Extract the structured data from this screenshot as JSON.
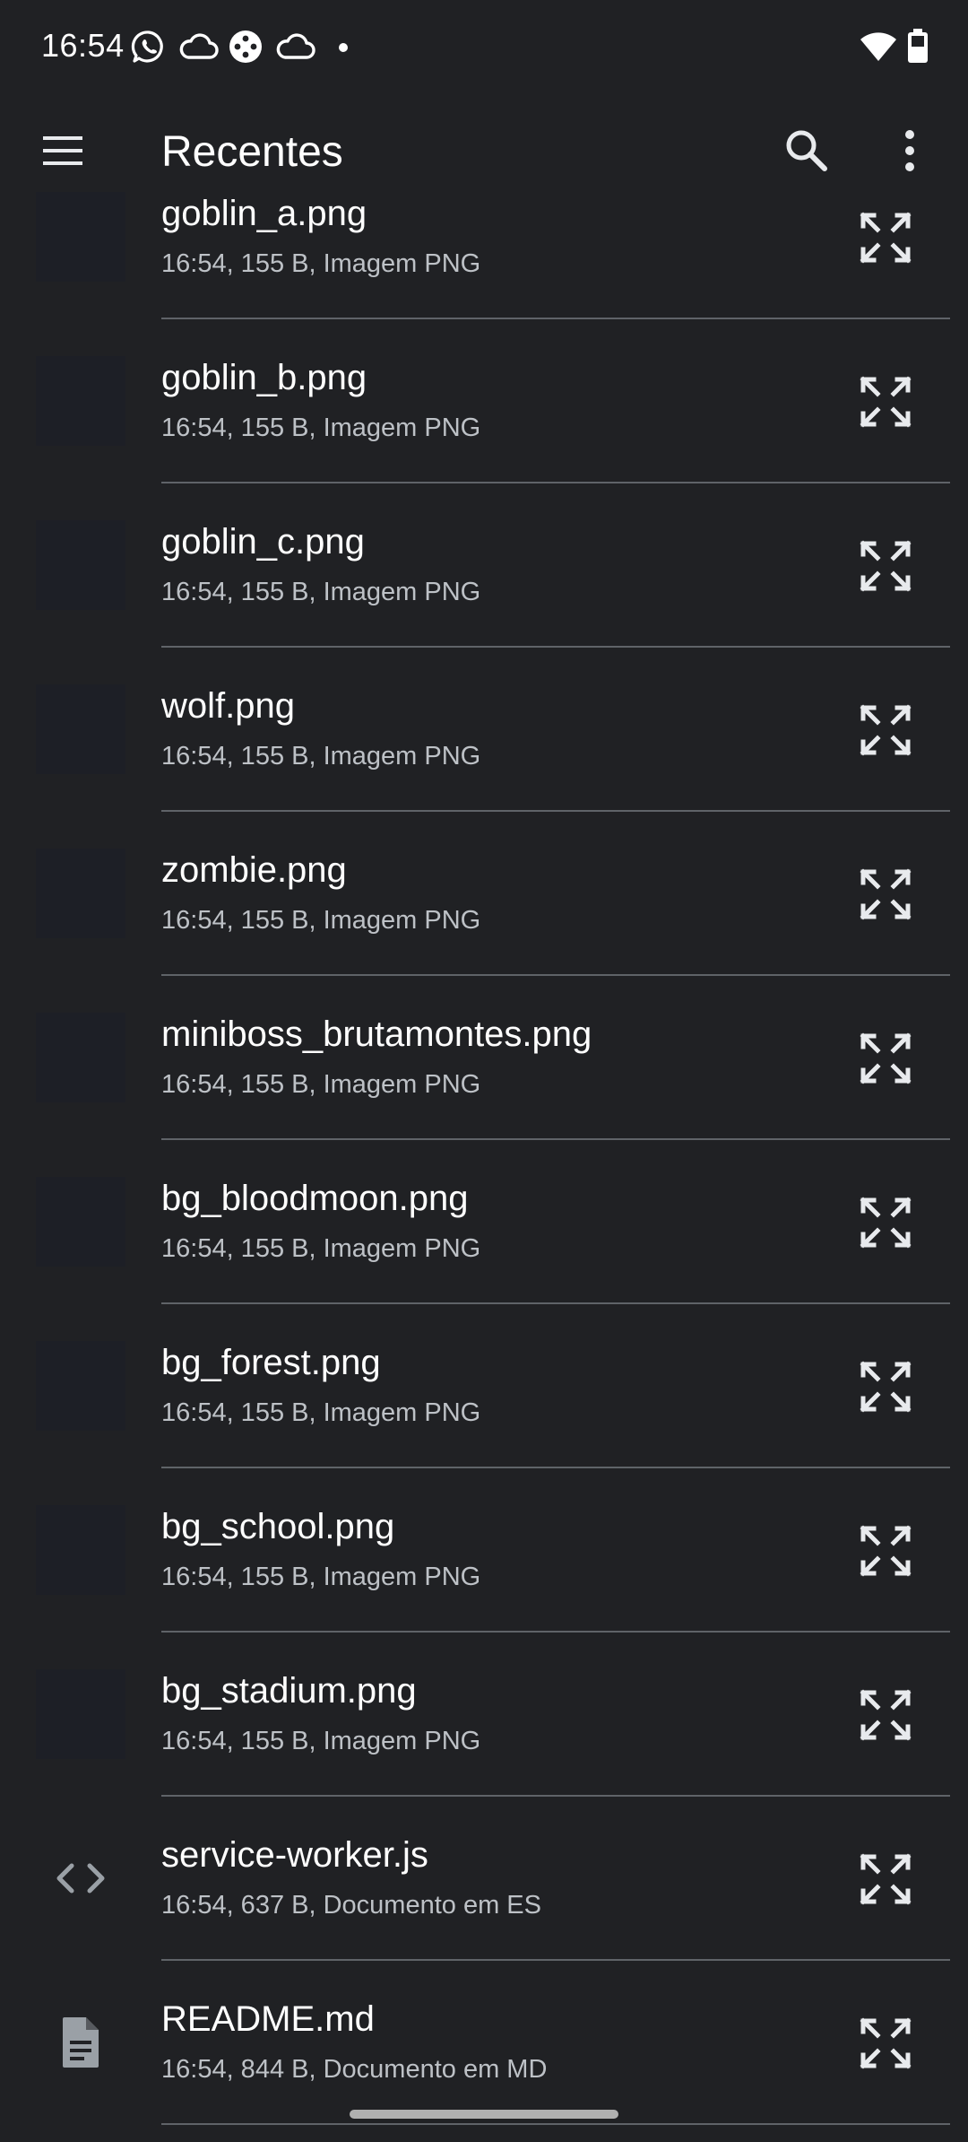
{
  "status_bar": {
    "time": "16:54",
    "icons": [
      "whatsapp-icon",
      "cloud-icon",
      "game-controller-icon",
      "cloud-icon",
      "wifi-icon",
      "battery-icon"
    ]
  },
  "app_bar": {
    "title": "Recentes",
    "menu_icon": "menu-icon",
    "search_icon": "search-icon",
    "more_icon": "more-vert-icon"
  },
  "files": [
    {
      "name": "goblin_a.png",
      "meta": "16:54, 155 B, Imagem PNG",
      "kind": "image"
    },
    {
      "name": "goblin_b.png",
      "meta": "16:54, 155 B, Imagem PNG",
      "kind": "image"
    },
    {
      "name": "goblin_c.png",
      "meta": "16:54, 155 B, Imagem PNG",
      "kind": "image"
    },
    {
      "name": "wolf.png",
      "meta": "16:54, 155 B, Imagem PNG",
      "kind": "image"
    },
    {
      "name": "zombie.png",
      "meta": "16:54, 155 B, Imagem PNG",
      "kind": "image"
    },
    {
      "name": "miniboss_brutamontes.png",
      "meta": "16:54, 155 B, Imagem PNG",
      "kind": "image"
    },
    {
      "name": "bg_bloodmoon.png",
      "meta": "16:54, 155 B, Imagem PNG",
      "kind": "image"
    },
    {
      "name": "bg_forest.png",
      "meta": "16:54, 155 B, Imagem PNG",
      "kind": "image"
    },
    {
      "name": "bg_school.png",
      "meta": "16:54, 155 B, Imagem PNG",
      "kind": "image"
    },
    {
      "name": "bg_stadium.png",
      "meta": "16:54, 155 B, Imagem PNG",
      "kind": "image"
    },
    {
      "name": "service-worker.js",
      "meta": "16:54, 637 B, Documento em ES",
      "kind": "code"
    },
    {
      "name": "README.md",
      "meta": "16:54, 844 B, Documento em MD",
      "kind": "document"
    }
  ],
  "colors": {
    "background": "#202124",
    "text_primary": "#ffffff",
    "text_secondary": "#bdc1c6",
    "divider": "#5f6368",
    "thumbnail": "#1d1f26"
  }
}
